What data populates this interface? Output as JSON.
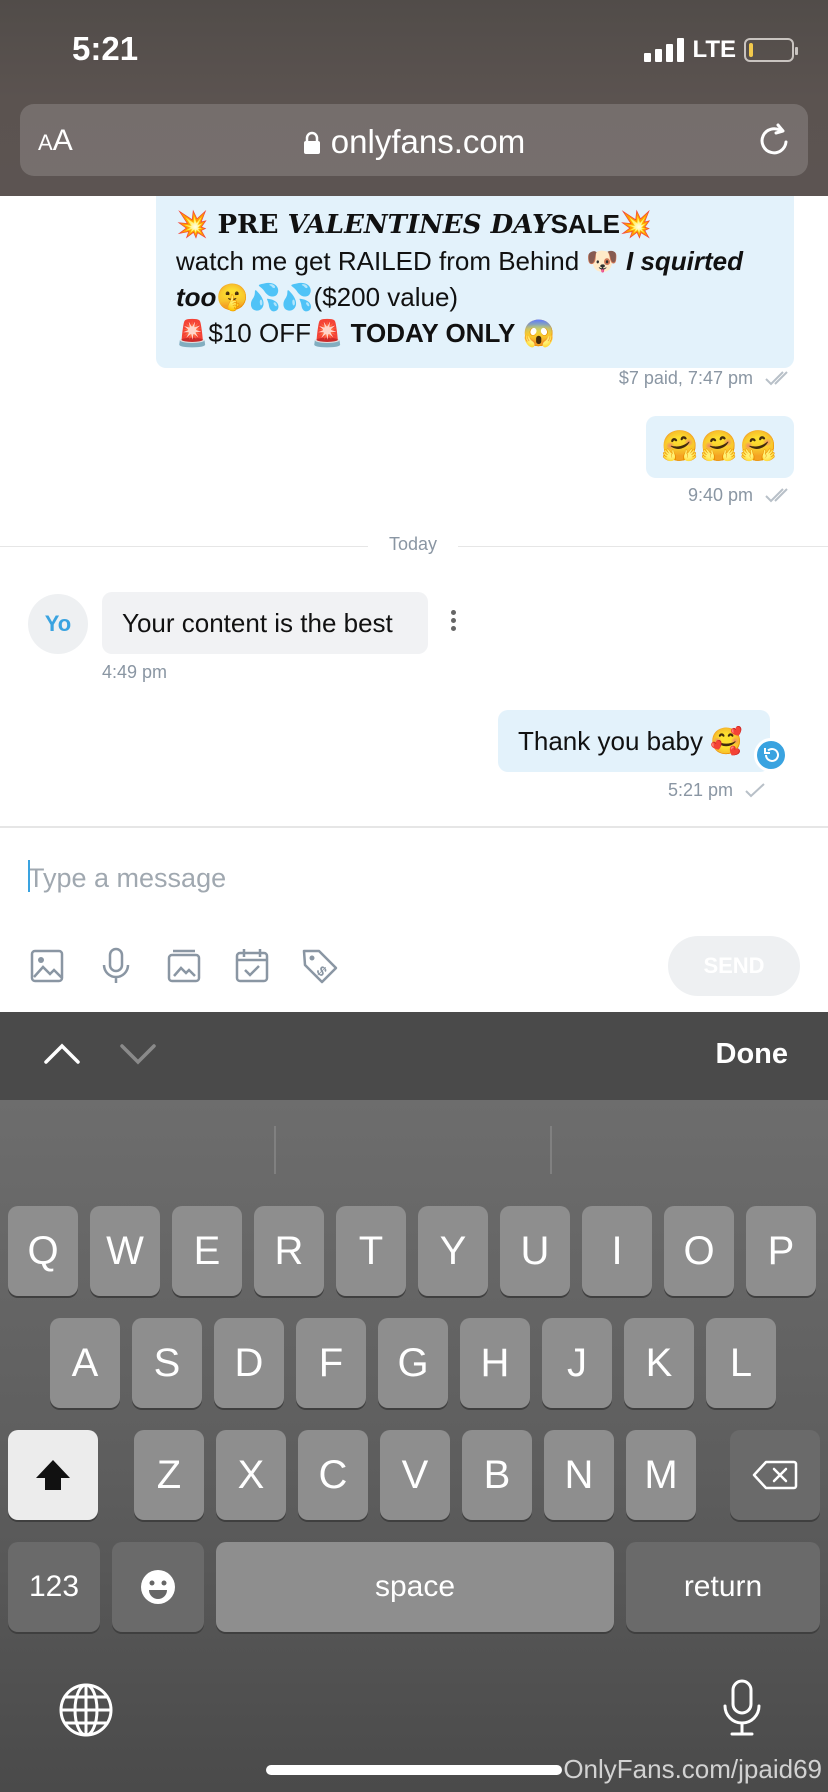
{
  "status": {
    "time": "5:21",
    "network": "LTE"
  },
  "browser": {
    "text_size": "AA",
    "url": "onlyfans.com"
  },
  "messages": {
    "promo": {
      "line1_prefix": "PRE ",
      "line1_italic": "VALENTINES DAY",
      "line1_suffix": "SALE",
      "line2": "watch me get RAILED from Behind 🐶 ",
      "line2_italic": "I squirted",
      "line3_italic": "too",
      "line3": "🤫💦💦($200 value)",
      "line4_a": "🚨$10 OFF🚨 ",
      "line4_b": "TODAY ONLY",
      "line4_c": " 😱",
      "meta": "$7 paid, 7:47 pm"
    },
    "emoji": {
      "text": "🤗🤗🤗",
      "meta": "9:40 pm"
    },
    "divider": "Today",
    "incoming": {
      "avatar": "Yo",
      "text": "Your content is the best",
      "meta": "4:49 pm"
    },
    "outgoing": {
      "text": "Thank you baby 🥰",
      "meta": "5:21 pm"
    }
  },
  "composer": {
    "placeholder": "Type a message",
    "send_label": "SEND"
  },
  "accessory": {
    "done_label": "Done"
  },
  "keyboard": {
    "row1": [
      "Q",
      "W",
      "E",
      "R",
      "T",
      "Y",
      "U",
      "I",
      "O",
      "P"
    ],
    "row2": [
      "A",
      "S",
      "D",
      "F",
      "G",
      "H",
      "J",
      "K",
      "L"
    ],
    "row3": [
      "Z",
      "X",
      "C",
      "V",
      "B",
      "N",
      "M"
    ],
    "numbers_label": "123",
    "space_label": "space",
    "return_label": "return"
  },
  "watermark": "OnlyFans.com/jpaid69",
  "colors": {
    "accent": "#3aa3e0",
    "bubble_out": "#e3f2fb",
    "bubble_in": "#f1f2f4"
  }
}
